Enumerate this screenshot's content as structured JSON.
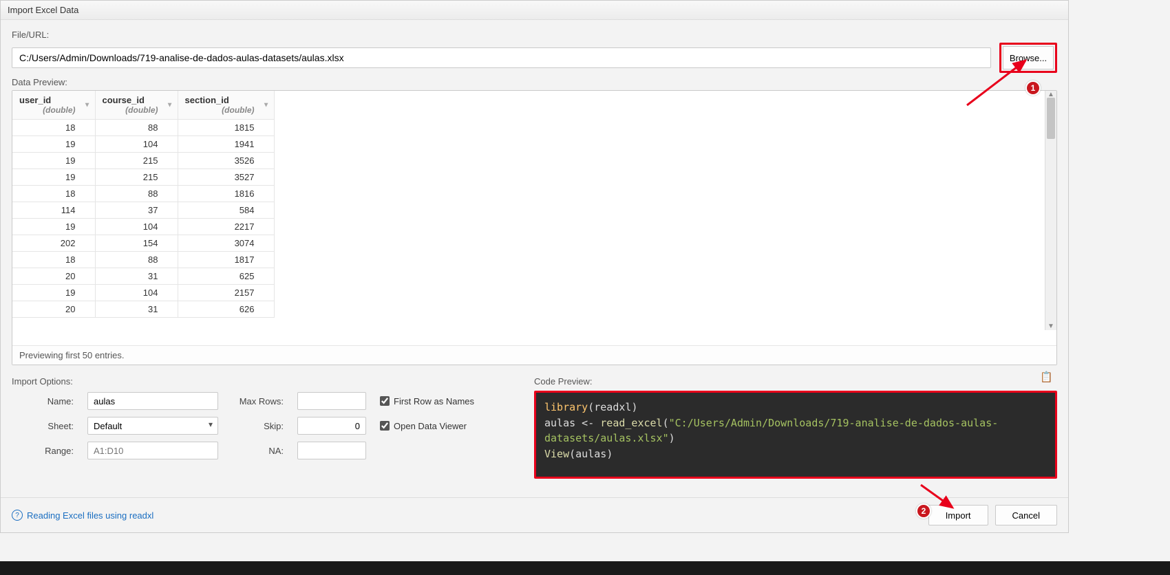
{
  "title": "Import Excel Data",
  "file": {
    "label": "File/URL:",
    "value": "C:/Users/Admin/Downloads/719-analise-de-dados-aulas-datasets/aulas.xlsx",
    "browse": "Browse..."
  },
  "preview": {
    "label": "Data Preview:",
    "columns": [
      {
        "name": "user_id",
        "type": "(double)"
      },
      {
        "name": "course_id",
        "type": "(double)"
      },
      {
        "name": "section_id",
        "type": "(double)"
      }
    ],
    "rows": [
      [
        18,
        88,
        1815
      ],
      [
        19,
        104,
        1941
      ],
      [
        19,
        215,
        3526
      ],
      [
        19,
        215,
        3527
      ],
      [
        18,
        88,
        1816
      ],
      [
        114,
        37,
        584
      ],
      [
        19,
        104,
        2217
      ],
      [
        202,
        154,
        3074
      ],
      [
        18,
        88,
        1817
      ],
      [
        20,
        31,
        625
      ],
      [
        19,
        104,
        2157
      ],
      [
        20,
        31,
        626
      ]
    ],
    "status": "Previewing first 50 entries."
  },
  "options": {
    "label": "Import Options:",
    "name_label": "Name:",
    "name_value": "aulas",
    "sheet_label": "Sheet:",
    "sheet_value": "Default",
    "range_label": "Range:",
    "range_placeholder": "A1:D10",
    "maxrows_label": "Max Rows:",
    "maxrows_value": "",
    "skip_label": "Skip:",
    "skip_value": "0",
    "na_label": "NA:",
    "na_value": "",
    "first_row": "First Row as Names",
    "open_viewer": "Open Data Viewer"
  },
  "code": {
    "label": "Code Preview:",
    "line1_fn": "library",
    "line1_arg": "readxl",
    "line2_var": "aulas",
    "line2_op": " <- ",
    "line2_fn": "read_excel",
    "line2_str": "\"C:/Users/Admin/Downloads/719-analise-de-dados-aulas-datasets/aulas.xlsx\"",
    "line3_fn": "View",
    "line3_arg": "aulas"
  },
  "footer": {
    "help": "Reading Excel files using readxl",
    "import": "Import",
    "cancel": "Cancel"
  },
  "annotations": {
    "badge1": "1",
    "badge2": "2"
  }
}
